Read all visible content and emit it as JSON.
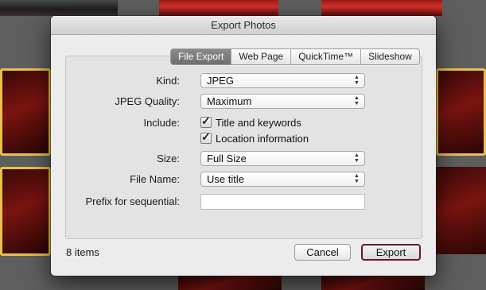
{
  "dialog": {
    "title": "Export Photos",
    "tabs": [
      {
        "label": "File Export",
        "active": true
      },
      {
        "label": "Web Page",
        "active": false
      },
      {
        "label": "QuickTime™",
        "active": false
      },
      {
        "label": "Slideshow",
        "active": false
      }
    ],
    "form": {
      "kind": {
        "label": "Kind:",
        "value": "JPEG"
      },
      "jpeg_quality": {
        "label": "JPEG Quality:",
        "value": "Maximum"
      },
      "include": {
        "label": "Include:",
        "title_keywords": {
          "label": "Title and keywords",
          "checked": true
        },
        "location": {
          "label": "Location information",
          "checked": true
        }
      },
      "size": {
        "label": "Size:",
        "value": "Full Size"
      },
      "file_name": {
        "label": "File Name:",
        "value": "Use title"
      },
      "prefix": {
        "label": "Prefix for sequential:",
        "value": ""
      }
    },
    "item_count": "8 items",
    "cancel_label": "Cancel",
    "export_label": "Export"
  },
  "colors": {
    "selection_border": "#e8c24a",
    "default_button_border": "#6a1626",
    "active_tab": "#7a7a7a"
  }
}
